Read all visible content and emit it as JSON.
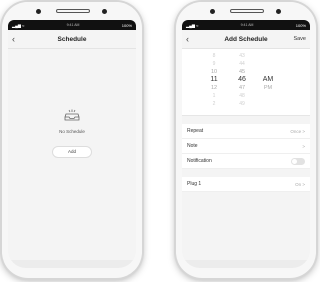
{
  "left_screen": {
    "status": {
      "time": "9:41 AM",
      "battery": "100%"
    },
    "nav": {
      "back_icon": "chevron-left-icon",
      "title": "Schedule"
    },
    "empty": {
      "icon": "empty-tray-icon",
      "text": "No Schedule"
    },
    "add_label": "Add"
  },
  "right_screen": {
    "status": {
      "time": "9:41 AM",
      "battery": "100%"
    },
    "nav": {
      "back_icon": "chevron-left-icon",
      "title": "Add Schedule",
      "save_label": "Save"
    },
    "picker": {
      "hours": [
        "8",
        "9",
        "10",
        "11",
        "12",
        "1",
        "2"
      ],
      "minutes": [
        "43",
        "44",
        "45",
        "46",
        "47",
        "48",
        "49"
      ],
      "ampm": [
        "AM",
        "PM"
      ],
      "selected": {
        "hour": "11",
        "minute": "46",
        "ampm": "AM"
      }
    },
    "rows": {
      "repeat": {
        "label": "Repeat",
        "value": "Once >"
      },
      "note": {
        "label": "Note",
        "value": ">"
      },
      "notification": {
        "label": "Notification",
        "enabled": false
      },
      "plug": {
        "label": "Plug 1",
        "value": "On >"
      }
    }
  },
  "colors": {
    "background": "#f4f4f4",
    "card": "#ffffff",
    "text": "#222222",
    "muted": "#aaaaaa"
  }
}
